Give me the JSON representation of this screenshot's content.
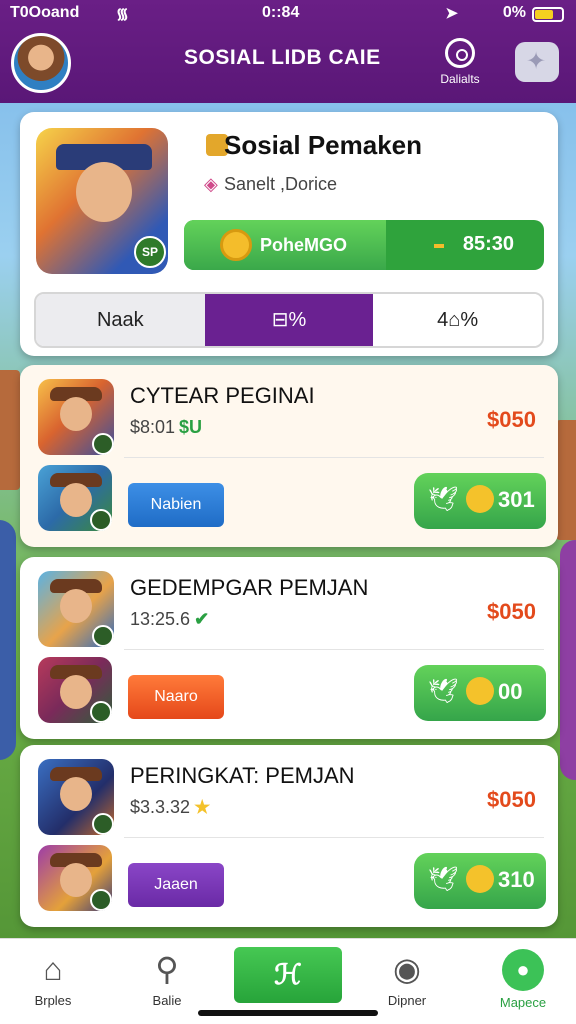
{
  "status_bar": {
    "carrier": "T0Ooand",
    "time": "0::84",
    "battery": "0%"
  },
  "header": {
    "title": "SOSIAL LIDB CAIE",
    "details_label": "Dalialts"
  },
  "profile": {
    "name": "Sosial Pemaken",
    "subtitle": "Sanelt ,Dorice",
    "icon_badge": "SP",
    "reward_label": "PoheMGO",
    "reward_value": "85:30",
    "tabs": [
      "Naak",
      "⊟%",
      "4⌂%"
    ]
  },
  "rows": [
    {
      "title": "CYTEAR PEGINAI",
      "price": "$8:01",
      "price_tag": "$U",
      "amount": "$050",
      "button_label": "Nabien",
      "share_value": "301"
    },
    {
      "title": "GEDEMPGAR PEMJAN",
      "price": "13:25.6",
      "price_tag": "✔",
      "amount": "$050",
      "button_label": "Naaro",
      "share_value": "00"
    },
    {
      "title": "PERINGKAT: PEMJAN",
      "price": "$3.3.32",
      "price_tag": "★",
      "amount": "$050",
      "button_label": "Jaaen",
      "share_value": "310"
    }
  ],
  "bottom_nav": {
    "items": [
      "Brples",
      "Balie",
      "Dipner",
      "Mapece"
    ],
    "center_icon": "ℋ"
  },
  "colors": {
    "header": "#5a1777",
    "accent_green": "#35a54a",
    "tab_active": "#6a2191",
    "amount_red": "#e34a1c"
  }
}
